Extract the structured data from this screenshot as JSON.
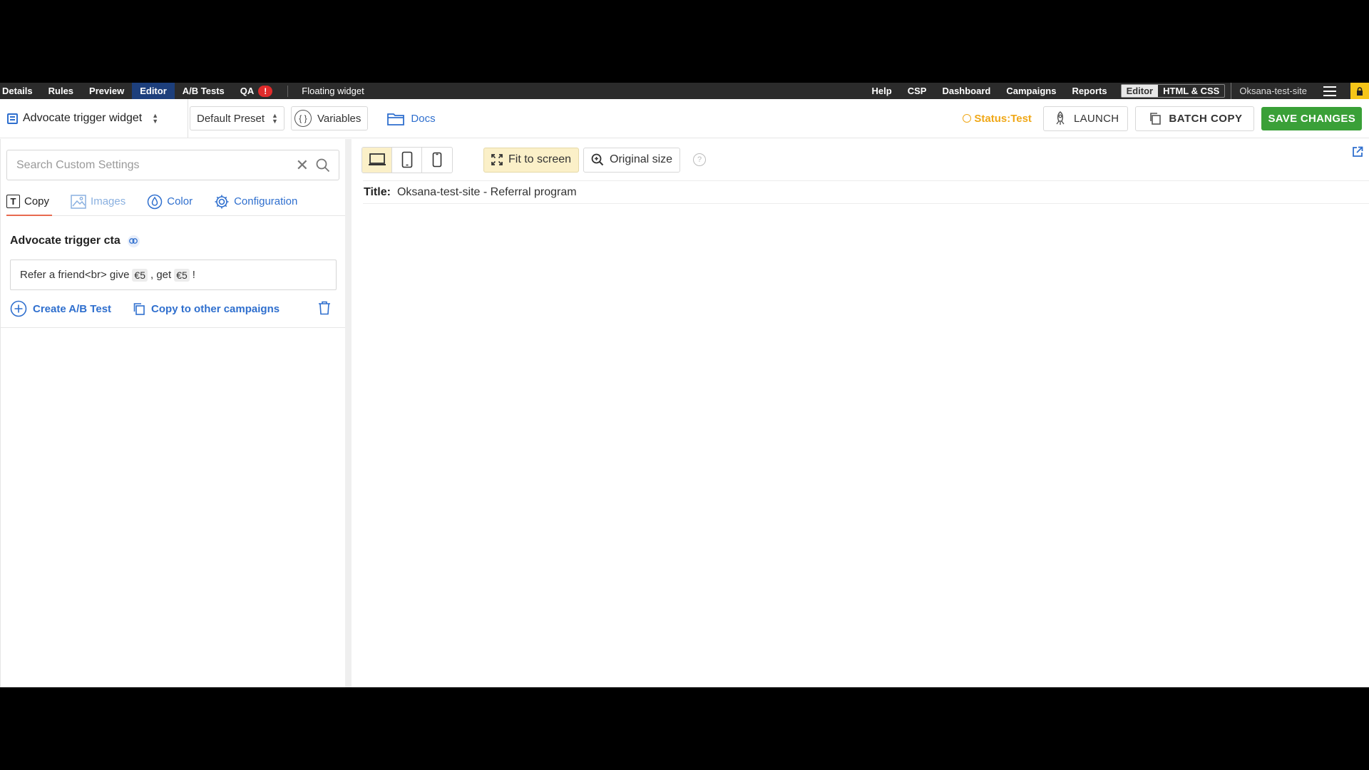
{
  "topnav": {
    "items": [
      "Details",
      "Rules",
      "Preview",
      "Editor",
      "A/B Tests",
      "QA"
    ],
    "active": "Editor",
    "qa_badge": "!",
    "widget_title": "Floating widget",
    "right_items": [
      "Help",
      "CSP",
      "Dashboard",
      "Campaigns",
      "Reports"
    ],
    "mode_toggle": [
      "Editor",
      "HTML & CSS"
    ],
    "site_name": "Oksana-test-site"
  },
  "toolbar": {
    "widget_select": "Advocate trigger widget",
    "preset_select": "Default Preset",
    "variables_label": "Variables",
    "docs_label": "Docs",
    "status_label": "Status:Test",
    "launch_label": "LAUNCH",
    "batch_copy_label": "BATCH COPY",
    "save_label": "SAVE CHANGES"
  },
  "left_panel": {
    "search_placeholder": "Search Custom Settings",
    "tabs": [
      "Copy",
      "Images",
      "Color",
      "Configuration"
    ],
    "active_tab": "Copy",
    "field_label": "Advocate trigger cta",
    "field_value": {
      "part1": "Refer a friend<br> give",
      "chip1": "€5",
      "part2": ", get",
      "chip2": "€5",
      "part3": "!"
    },
    "create_ab_test": "Create A/B Test",
    "copy_to_other": "Copy to other campaigns"
  },
  "preview": {
    "fit_to_screen": "Fit to screen",
    "original_size": "Original size",
    "help_glyph": "?",
    "title_label": "Title:",
    "title_value": "Oksana-test-site - Referral program"
  },
  "colors": {
    "accent_blue": "#2f6fce",
    "save_green": "#3aa038",
    "status_orange": "#f0a818",
    "nav_active": "#1d3f7c",
    "qa_red": "#e02b2b"
  }
}
